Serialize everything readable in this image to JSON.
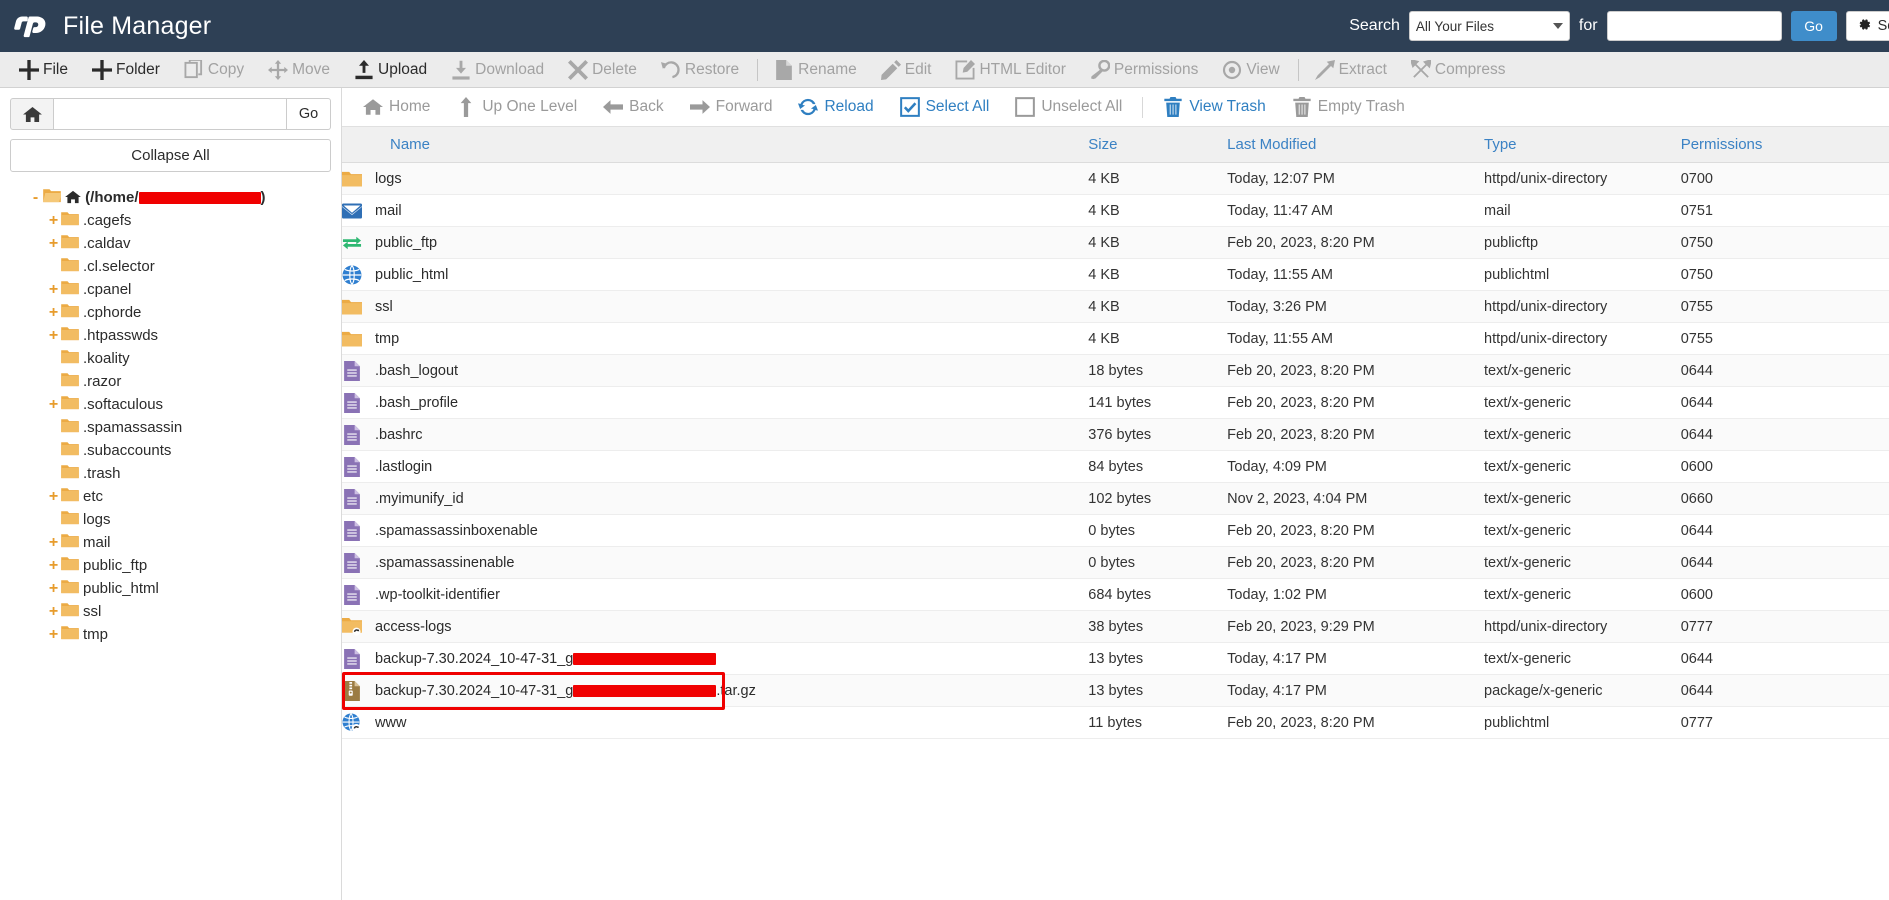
{
  "header": {
    "app_title": "File Manager",
    "logo_icon": "cpanel-logo-icon",
    "search_label": "Search",
    "search_scope_value": "All Your Files",
    "search_scope_icon": "chevron-down-icon",
    "for_label": "for",
    "search_placeholder": "",
    "search_value": "",
    "go_label": "Go",
    "settings_label": "Settings",
    "settings_icon": "gear-icon",
    "bg_color": "#2e4055",
    "accent_color": "#3f8dca"
  },
  "toolbar": {
    "items": [
      {
        "label": "File",
        "icon": "plus-icon",
        "enabled": true
      },
      {
        "label": "Folder",
        "icon": "plus-icon",
        "enabled": true
      },
      {
        "label": "Copy",
        "icon": "copy-icon",
        "enabled": false
      },
      {
        "label": "Move",
        "icon": "move-arrows-icon",
        "enabled": false
      },
      {
        "label": "Upload",
        "icon": "upload-icon",
        "enabled": true
      },
      {
        "label": "Download",
        "icon": "download-icon",
        "enabled": false
      },
      {
        "label": "Delete",
        "icon": "x-icon",
        "enabled": false
      },
      {
        "label": "Restore",
        "icon": "undo-icon",
        "enabled": false
      },
      {
        "sep": true
      },
      {
        "label": "Rename",
        "icon": "file-icon",
        "enabled": false
      },
      {
        "label": "Edit",
        "icon": "pencil-icon",
        "enabled": false
      },
      {
        "label": "HTML Editor",
        "icon": "edit-square-icon",
        "enabled": false
      },
      {
        "label": "Permissions",
        "icon": "key-icon",
        "enabled": false
      },
      {
        "label": "View",
        "icon": "eye-icon",
        "enabled": false
      },
      {
        "sep": true
      },
      {
        "label": "Extract",
        "icon": "expand-icon",
        "enabled": false
      },
      {
        "label": "Compress",
        "icon": "compress-icon",
        "enabled": false
      }
    ]
  },
  "sidebar": {
    "home_icon": "home-icon",
    "path_value": "",
    "path_placeholder": "",
    "go_label": "Go",
    "collapse_all_label": "Collapse All",
    "tree": [
      {
        "label": "(/home/",
        "suffix": ")",
        "redacted": true,
        "toggle": "-",
        "indent": 0,
        "root": true,
        "icon": "folder-open-home-icon"
      },
      {
        "label": ".cagefs",
        "toggle": "+",
        "indent": 1,
        "icon": "folder-icon"
      },
      {
        "label": ".caldav",
        "toggle": "+",
        "indent": 1,
        "icon": "folder-icon"
      },
      {
        "label": ".cl.selector",
        "toggle": "",
        "indent": 1,
        "icon": "folder-icon"
      },
      {
        "label": ".cpanel",
        "toggle": "+",
        "indent": 1,
        "icon": "folder-icon"
      },
      {
        "label": ".cphorde",
        "toggle": "+",
        "indent": 1,
        "icon": "folder-icon"
      },
      {
        "label": ".htpasswds",
        "toggle": "+",
        "indent": 1,
        "icon": "folder-icon"
      },
      {
        "label": ".koality",
        "toggle": "",
        "indent": 1,
        "icon": "folder-icon"
      },
      {
        "label": ".razor",
        "toggle": "",
        "indent": 1,
        "icon": "folder-icon"
      },
      {
        "label": ".softaculous",
        "toggle": "+",
        "indent": 1,
        "icon": "folder-icon"
      },
      {
        "label": ".spamassassin",
        "toggle": "",
        "indent": 1,
        "icon": "folder-icon"
      },
      {
        "label": ".subaccounts",
        "toggle": "",
        "indent": 1,
        "icon": "folder-icon"
      },
      {
        "label": ".trash",
        "toggle": "",
        "indent": 1,
        "icon": "folder-icon"
      },
      {
        "label": "etc",
        "toggle": "+",
        "indent": 1,
        "icon": "folder-icon"
      },
      {
        "label": "logs",
        "toggle": "",
        "indent": 1,
        "icon": "folder-icon"
      },
      {
        "label": "mail",
        "toggle": "+",
        "indent": 1,
        "icon": "folder-icon"
      },
      {
        "label": "public_ftp",
        "toggle": "+",
        "indent": 1,
        "icon": "folder-icon"
      },
      {
        "label": "public_html",
        "toggle": "+",
        "indent": 1,
        "icon": "folder-icon"
      },
      {
        "label": "ssl",
        "toggle": "+",
        "indent": 1,
        "icon": "folder-icon"
      },
      {
        "label": "tmp",
        "toggle": "+",
        "indent": 1,
        "icon": "folder-icon"
      }
    ]
  },
  "navbar": {
    "items": [
      {
        "label": "Home",
        "icon": "home-icon",
        "style": "muted"
      },
      {
        "label": "Up One Level",
        "icon": "up-arrow-icon",
        "style": "muted"
      },
      {
        "label": "Back",
        "icon": "left-arrow-icon",
        "style": "muted"
      },
      {
        "label": "Forward",
        "icon": "right-arrow-icon",
        "style": "muted"
      },
      {
        "label": "Reload",
        "icon": "reload-icon",
        "style": "link"
      },
      {
        "label": "Select All",
        "icon": "checkbox-checked-icon",
        "style": "link"
      },
      {
        "label": "Unselect All",
        "icon": "checkbox-empty-icon",
        "style": "muted"
      },
      {
        "sep": true
      },
      {
        "label": "View Trash",
        "icon": "trash-icon",
        "style": "link"
      },
      {
        "label": "Empty Trash",
        "icon": "trash-icon",
        "style": "muted"
      }
    ]
  },
  "table": {
    "columns": [
      "Name",
      "Size",
      "Last Modified",
      "Type",
      "Permissions"
    ],
    "rows": [
      {
        "name": "logs",
        "icon": "folder-icon",
        "size": "4 KB",
        "modified": "Today, 12:07 PM",
        "type": "httpd/unix-directory",
        "perms": "0700"
      },
      {
        "name": "mail",
        "icon": "mail-icon",
        "size": "4 KB",
        "modified": "Today, 11:47 AM",
        "type": "mail",
        "perms": "0751"
      },
      {
        "name": "public_ftp",
        "icon": "ftp-icon",
        "size": "4 KB",
        "modified": "Feb 20, 2023, 8:20 PM",
        "type": "publicftp",
        "perms": "0750"
      },
      {
        "name": "public_html",
        "icon": "globe-icon",
        "size": "4 KB",
        "modified": "Today, 11:55 AM",
        "type": "publichtml",
        "perms": "0750"
      },
      {
        "name": "ssl",
        "icon": "folder-icon",
        "size": "4 KB",
        "modified": "Today, 3:26 PM",
        "type": "httpd/unix-directory",
        "perms": "0755"
      },
      {
        "name": "tmp",
        "icon": "folder-icon",
        "size": "4 KB",
        "modified": "Today, 11:55 AM",
        "type": "httpd/unix-directory",
        "perms": "0755"
      },
      {
        "name": ".bash_logout",
        "icon": "text-file-icon",
        "size": "18 bytes",
        "modified": "Feb 20, 2023, 8:20 PM",
        "type": "text/x-generic",
        "perms": "0644"
      },
      {
        "name": ".bash_profile",
        "icon": "text-file-icon",
        "size": "141 bytes",
        "modified": "Feb 20, 2023, 8:20 PM",
        "type": "text/x-generic",
        "perms": "0644"
      },
      {
        "name": ".bashrc",
        "icon": "text-file-icon",
        "size": "376 bytes",
        "modified": "Feb 20, 2023, 8:20 PM",
        "type": "text/x-generic",
        "perms": "0644"
      },
      {
        "name": ".lastlogin",
        "icon": "text-file-icon",
        "size": "84 bytes",
        "modified": "Today, 4:09 PM",
        "type": "text/x-generic",
        "perms": "0600"
      },
      {
        "name": ".myimunify_id",
        "icon": "text-file-icon",
        "size": "102 bytes",
        "modified": "Nov 2, 2023, 4:04 PM",
        "type": "text/x-generic",
        "perms": "0660"
      },
      {
        "name": ".spamassassinboxenable",
        "icon": "text-file-icon",
        "size": "0 bytes",
        "modified": "Feb 20, 2023, 8:20 PM",
        "type": "text/x-generic",
        "perms": "0644"
      },
      {
        "name": ".spamassassinenable",
        "icon": "text-file-icon",
        "size": "0 bytes",
        "modified": "Feb 20, 2023, 8:20 PM",
        "type": "text/x-generic",
        "perms": "0644"
      },
      {
        "name": ".wp-toolkit-identifier",
        "icon": "text-file-icon",
        "size": "684 bytes",
        "modified": "Today, 1:02 PM",
        "type": "text/x-generic",
        "perms": "0600"
      },
      {
        "name": "access-logs",
        "icon": "folder-link-icon",
        "size": "38 bytes",
        "modified": "Feb 20, 2023, 9:29 PM",
        "type": "httpd/unix-directory",
        "perms": "0777"
      },
      {
        "name": "backup-7.30.2024_10-47-31_g",
        "name_redacted": true,
        "name_suffix": "",
        "icon": "text-file-icon",
        "size": "13 bytes",
        "modified": "Today, 4:17 PM",
        "type": "text/x-generic",
        "perms": "0644"
      },
      {
        "name": "backup-7.30.2024_10-47-31_g",
        "name_redacted": true,
        "name_suffix": ".tar.gz",
        "icon": "archive-icon",
        "size": "13 bytes",
        "modified": "Today, 4:17 PM",
        "type": "package/x-generic",
        "perms": "0644",
        "highlighted": true
      },
      {
        "name": "www",
        "icon": "globe-link-icon",
        "size": "11 bytes",
        "modified": "Feb 20, 2023, 8:20 PM",
        "type": "publichtml",
        "perms": "0777"
      }
    ]
  },
  "annotations": {
    "highlight_color": "#ef0000",
    "redaction_color": "#f00000"
  }
}
